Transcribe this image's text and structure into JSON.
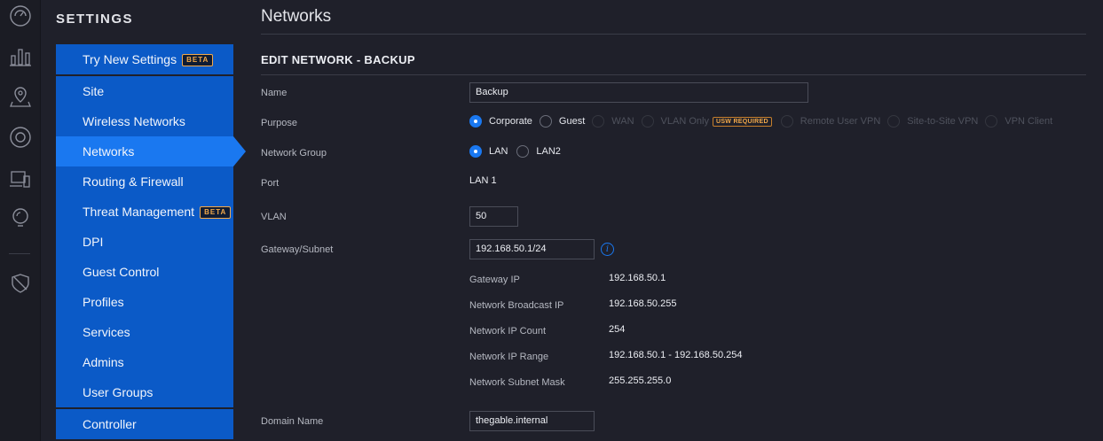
{
  "rail": {
    "icons": [
      "dashboard-icon",
      "statistics-icon",
      "map-icon",
      "devices-icon",
      "clients-icon",
      "insights-icon",
      "alerts-icon"
    ]
  },
  "settings": {
    "title": "SETTINGS",
    "try_new": {
      "label": "Try New Settings",
      "badge": "BETA"
    },
    "items": [
      {
        "label": "Site"
      },
      {
        "label": "Wireless Networks"
      },
      {
        "label": "Networks"
      },
      {
        "label": "Routing & Firewall"
      },
      {
        "label": "Threat Management",
        "badge": "BETA"
      },
      {
        "label": "DPI"
      },
      {
        "label": "Guest Control"
      },
      {
        "label": "Profiles"
      },
      {
        "label": "Services"
      },
      {
        "label": "Admins"
      },
      {
        "label": "User Groups"
      }
    ],
    "controller": {
      "label": "Controller"
    },
    "active": "Networks"
  },
  "main": {
    "page_title": "Networks",
    "section_title": "EDIT NETWORK - BACKUP",
    "name": {
      "label": "Name",
      "value": "Backup"
    },
    "purpose": {
      "label": "Purpose",
      "options": [
        {
          "label": "Corporate",
          "selected": true,
          "disabled": false
        },
        {
          "label": "Guest",
          "selected": false,
          "disabled": false
        },
        {
          "label": "WAN",
          "selected": false,
          "disabled": true
        },
        {
          "label": "VLAN Only",
          "selected": false,
          "disabled": true,
          "badge": "USW REQUIRED"
        },
        {
          "label": "Remote User VPN",
          "selected": false,
          "disabled": true
        },
        {
          "label": "Site-to-Site VPN",
          "selected": false,
          "disabled": true
        },
        {
          "label": "VPN Client",
          "selected": false,
          "disabled": true
        }
      ]
    },
    "network_group": {
      "label": "Network Group",
      "options": [
        {
          "label": "LAN",
          "selected": true
        },
        {
          "label": "LAN2",
          "selected": false
        }
      ]
    },
    "port": {
      "label": "Port",
      "value": "LAN 1"
    },
    "vlan": {
      "label": "VLAN",
      "value": "50"
    },
    "gateway_subnet": {
      "label": "Gateway/Subnet",
      "value": "192.168.50.1/24"
    },
    "subnet_info": [
      {
        "label": "Gateway IP",
        "value": "192.168.50.1"
      },
      {
        "label": "Network Broadcast IP",
        "value": "192.168.50.255"
      },
      {
        "label": "Network IP Count",
        "value": "254"
      },
      {
        "label": "Network IP Range",
        "value": "192.168.50.1 - 192.168.50.254"
      },
      {
        "label": "Network Subnet Mask",
        "value": "255.255.255.0"
      }
    ],
    "domain_name": {
      "label": "Domain Name",
      "value": "thegable.internal"
    }
  },
  "colors": {
    "accent": "#1a78f0",
    "nav_bg": "#0b5ac7",
    "beta_badge": "#f3a94a",
    "background": "#1f202a"
  }
}
